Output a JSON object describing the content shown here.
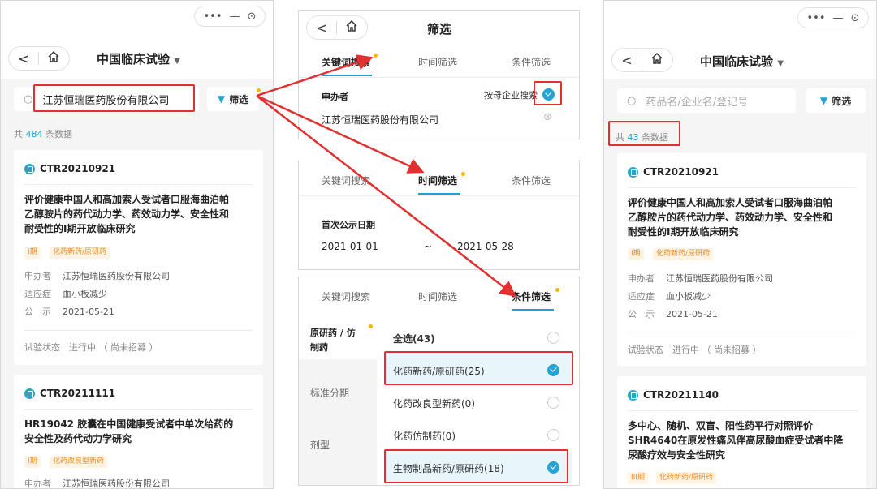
{
  "app": {
    "title": "中国临床试验",
    "title_arrow": "▼",
    "capsule_dots": "•••",
    "capsule_min": "—",
    "capsule_rec": "⊙",
    "back": "<"
  },
  "left": {
    "search_value": "江苏恒瑞医药股份有限公司",
    "filter_label": "筛选",
    "count_pre": "共",
    "count_num": "484",
    "count_post": "条数据",
    "card1": {
      "id": "CTR20210921",
      "title_l1": "评价健康中国人和高加索人受试者口服海曲泊帕",
      "title_l2": "乙醇胺片的药代动力学、药效动力学、安全性和",
      "title_l3": "耐受性的I期开放临床研究",
      "tag1": "I期",
      "tag2": "化药新药/原研药",
      "sponsor_k": "申办者",
      "sponsor_v": "江苏恒瑞医药股份有限公司",
      "ind_k": "适应症",
      "ind_v": "血小板减少",
      "pub_k": "公　示",
      "pub_v": "2021-05-21",
      "status_k": "试验状态",
      "status_v": "进行中 （ 尚未招募 ）"
    },
    "card2": {
      "id": "CTR20211111",
      "title_l1": "HR19042 胶囊在中国健康受试者中单次给药的",
      "title_l2": "安全性及药代动力学研究",
      "tag1": "I期",
      "tag2": "化药改良型新药",
      "sponsor_k": "申办者",
      "sponsor_v": "江苏恒瑞医药股份有限公司"
    }
  },
  "mid": {
    "title": "筛选",
    "back": "<",
    "tab_keyword": "关键词搜索",
    "tab_time": "时间筛选",
    "tab_cond": "条件筛选",
    "sponsor_label": "申办者",
    "parent_label": "按母企业搜索",
    "sponsor_value": "江苏恒瑞医药股份有限公司",
    "clear": "⊗",
    "date_label": "首次公示日期",
    "date_from": "2021-01-01",
    "date_sep": "~",
    "date_to": "2021-05-28",
    "cat1": "原研药 / 仿",
    "cat1b": "制药",
    "cat2": "标准分期",
    "cat3": "剂型",
    "opt_all": "全选(43)",
    "opt1": "化药新药/原研药(25)",
    "opt2": "化药改良型新药(0)",
    "opt3": "化药仿制药(0)",
    "opt4": "生物制品新药/原研药(18)"
  },
  "right": {
    "search_placeholder": "药品名/企业名/登记号",
    "filter_label": "筛选",
    "count_pre": "共",
    "count_num": "43",
    "count_post": "条数据",
    "card1": {
      "id": "CTR20210921",
      "title_l1": "评价健康中国人和高加索人受试者口服海曲泊帕",
      "title_l2": "乙醇胺片的药代动力学、药效动力学、安全性和",
      "title_l3": "耐受性的I期开放临床研究",
      "tag1": "I期",
      "tag2": "化药新药/原研药",
      "sponsor_k": "申办者",
      "sponsor_v": "江苏恒瑞医药股份有限公司",
      "ind_k": "适应症",
      "ind_v": "血小板减少",
      "pub_k": "公　示",
      "pub_v": "2021-05-21",
      "status_k": "试验状态",
      "status_v": "进行中 （ 尚未招募 ）"
    },
    "card2": {
      "id": "CTR20211140",
      "title_l1": "多中心、随机、双盲、阳性药平行对照评价",
      "title_l2": "SHR4640在原发性痛风伴高尿酸血症受试者中降",
      "title_l3": "尿酸疗效与安全性研究",
      "tag1": "III期",
      "tag2": "化药新药/原研药"
    }
  },
  "colors": {
    "accent": "#20a0d0",
    "red": "#e23030",
    "tag": "#e8902a"
  }
}
